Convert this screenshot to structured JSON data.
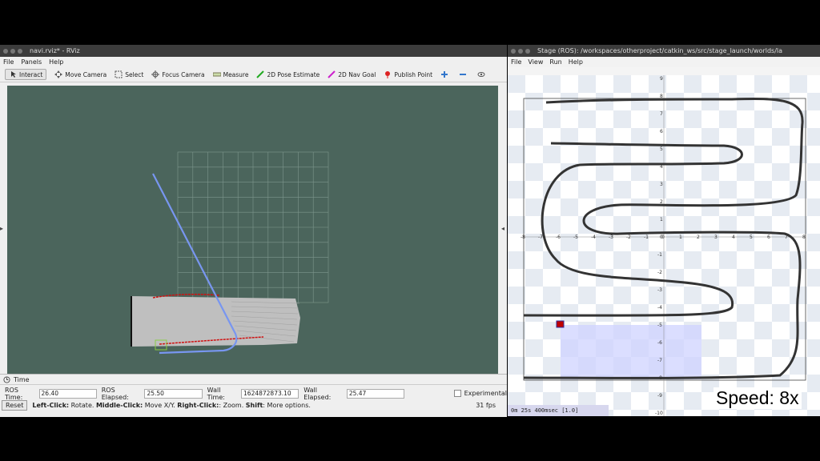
{
  "rviz": {
    "title": "navi.rviz* - RViz",
    "menu": [
      "File",
      "Panels",
      "Help"
    ],
    "tools": [
      {
        "label": "Interact",
        "icon": "interact-icon"
      },
      {
        "label": "Move Camera",
        "icon": "move-camera-icon"
      },
      {
        "label": "Select",
        "icon": "select-icon"
      },
      {
        "label": "Focus Camera",
        "icon": "focus-camera-icon"
      },
      {
        "label": "Measure",
        "icon": "measure-icon"
      },
      {
        "label": "2D Pose Estimate",
        "icon": "pose-estimate-icon"
      },
      {
        "label": "2D Nav Goal",
        "icon": "nav-goal-icon"
      },
      {
        "label": "Publish Point",
        "icon": "publish-point-icon"
      }
    ],
    "time_panel": {
      "header": "Time",
      "ros_time_label": "ROS Time:",
      "ros_time": "26.40",
      "ros_elapsed_label": "ROS Elapsed:",
      "ros_elapsed": "25.50",
      "wall_time_label": "Wall Time:",
      "wall_time": "1624872873.10",
      "wall_elapsed_label": "Wall Elapsed:",
      "wall_elapsed": "25.47",
      "experimental_label": "Experimental",
      "reset_label": "Reset",
      "hint_left": "Left-Click:",
      "hint_left_text": " Rotate. ",
      "hint_middle": "Middle-Click:",
      "hint_middle_text": " Move X/Y. ",
      "hint_right": "Right-Click:",
      "hint_right_text": ": Zoom. ",
      "hint_shift": "Shift",
      "hint_shift_text": ": More options.",
      "fps": "31 fps"
    }
  },
  "stage": {
    "title": "Stage (ROS): /workspaces/otherproject/catkin_ws/src/stage_launch/worlds/la",
    "menu": [
      "File",
      "View",
      "Run",
      "Help"
    ],
    "sim_time": "0m 25s 400msec [1.0]",
    "speed_label": "Speed: 8x",
    "x_ticks": [
      "-8",
      "-7",
      "-6",
      "-5",
      "-4",
      "-3",
      "-2",
      "-1",
      "0",
      "1",
      "2",
      "3",
      "4",
      "5",
      "6",
      "7",
      "8"
    ],
    "y_ticks": [
      "9",
      "8",
      "7",
      "6",
      "5",
      "4",
      "3",
      "2",
      "1",
      "0",
      "-1",
      "-2",
      "-3",
      "-4",
      "-5",
      "-6",
      "-7",
      "-8",
      "-9",
      "-10"
    ]
  },
  "colors": {
    "viewport_bg": "#4b655c",
    "path": "#7896f0",
    "scan_red": "#d01010",
    "robot_red": "#c00000",
    "stage_wall": "#333333"
  }
}
